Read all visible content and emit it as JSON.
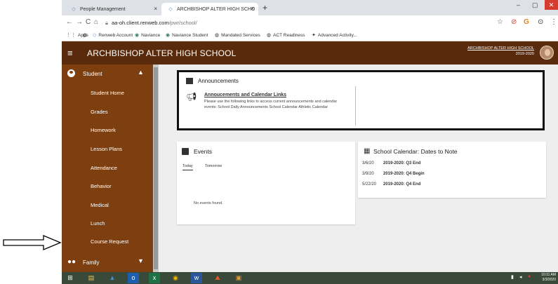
{
  "browser": {
    "tabs": [
      {
        "title": "People Management",
        "close": "×"
      },
      {
        "title": "ARCHBISHOP ALTER HIGH SCHO",
        "close": "×"
      }
    ],
    "new_tab": "+",
    "window": {
      "min": "–",
      "max": "▢",
      "close": "✕"
    },
    "nav": {
      "back": "←",
      "forward": "→",
      "reload": "C",
      "home": "⌂"
    },
    "url_host": "aa-oh.client.renweb.com",
    "url_path": "/pwr/school/",
    "right_icons": [
      "☆",
      "⊘",
      "G",
      "⊙",
      "⋮"
    ],
    "bookmarks": [
      {
        "icon": "⋮⋮",
        "label": "Apps"
      },
      {
        "icon": "◍",
        "label": ""
      },
      {
        "icon": "◇",
        "label": "Renweb Account"
      },
      {
        "icon": "◉",
        "label": "Naviance"
      },
      {
        "icon": "◉",
        "label": "Naviance Student"
      },
      {
        "icon": "◍",
        "label": "Mandated Services"
      },
      {
        "icon": "◍",
        "label": "ACT Readiness"
      },
      {
        "icon": "✦",
        "label": "Advanced Activity..."
      }
    ]
  },
  "header": {
    "menu_icon": "≡",
    "school_name": "ARCHBISHOP ALTER HIGH SCHOOL",
    "right_name": "ARCHBISHOP ALTER HIGH SCHOOL",
    "right_year": "2019-2020"
  },
  "sidebar": {
    "section": "Student",
    "section_chevron": "▲",
    "items": [
      "Student Home",
      "Grades",
      "Homework",
      "Lesson Plans",
      "Attendance",
      "Behavior",
      "Medical",
      "Lunch",
      "Course Request"
    ],
    "footer": "Family",
    "footer_chevron": "▼"
  },
  "announcements": {
    "title": "Announcements",
    "link": "Annoucements and Calendar Links",
    "body": "Please use the following links to access current announcements and calendar events: School Daily Announcements School Calendar Athletic Calendar"
  },
  "events": {
    "title": "Events",
    "tabs": [
      "Today",
      "Tomorrow"
    ],
    "empty": "No events found."
  },
  "calendar": {
    "title": "School Calendar: Dates to Note",
    "rows": [
      {
        "date": "3/6/20",
        "desc": "2019-2020: Q3 End"
      },
      {
        "date": "3/9/20",
        "desc": "2019-2020: Q4 Begin"
      },
      {
        "date": "5/22/20",
        "desc": "2019-2020: Q4 End"
      }
    ]
  },
  "taskbar": {
    "time": "10:11 AM",
    "date": "3/3/2020",
    "items": [
      "⊞",
      "▤",
      "▲",
      "o",
      "x",
      "◉",
      "w",
      "⛰",
      "▣"
    ]
  },
  "colors": {
    "header": "#5a2a0c",
    "sidebar": "#7d3f0f",
    "main_bg": "#eeeeee"
  }
}
